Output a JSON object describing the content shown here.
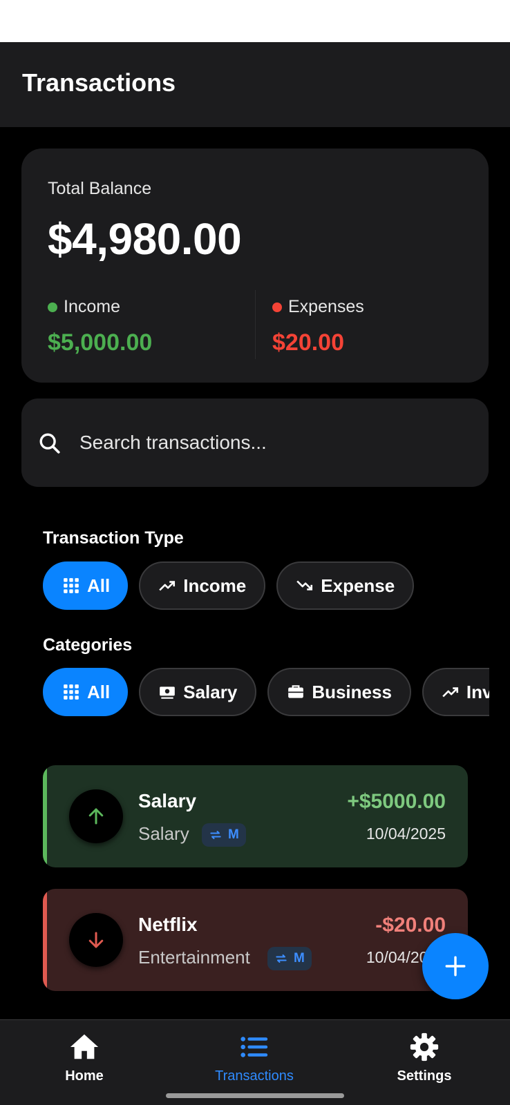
{
  "app_bar": {
    "title": "Transactions"
  },
  "balance": {
    "label": "Total Balance",
    "amount": "$4,980.00",
    "income": {
      "label": "Income",
      "value": "$5,000.00",
      "color": "#4caf50"
    },
    "expenses": {
      "label": "Expenses",
      "value": "$20.00",
      "color": "#f44336"
    }
  },
  "search": {
    "placeholder": "Search transactions...",
    "icon": "search-icon"
  },
  "filters": {
    "type_title": "Transaction Type",
    "types": [
      {
        "label": "All",
        "icon": "grid-icon",
        "active": true
      },
      {
        "label": "Income",
        "icon": "trending-up-icon",
        "active": false
      },
      {
        "label": "Expense",
        "icon": "trending-down-icon",
        "active": false
      }
    ],
    "category_title": "Categories",
    "categories": [
      {
        "label": "All",
        "icon": "grid-icon",
        "active": true
      },
      {
        "label": "Salary",
        "icon": "money-icon",
        "active": false
      },
      {
        "label": "Business",
        "icon": "briefcase-icon",
        "active": false
      },
      {
        "label": "Inv",
        "icon": "trending-up-icon",
        "active": false
      }
    ]
  },
  "transactions": [
    {
      "title": "Salary",
      "category": "Salary",
      "badge": "M",
      "amount": "+$5000.00",
      "date": "10/04/2025",
      "kind": "income",
      "amount_color": "#7ec97f",
      "accent": "#5cb85c"
    },
    {
      "title": "Netflix",
      "category": "Entertainment",
      "badge": "M",
      "amount": "-$20.00",
      "date": "10/04/2025",
      "kind": "expense",
      "amount_color": "#f0807a",
      "accent": "#e05a50"
    }
  ],
  "bottom_nav": [
    {
      "label": "Home",
      "icon": "home-icon",
      "active": false
    },
    {
      "label": "Transactions",
      "icon": "list-icon",
      "active": true
    },
    {
      "label": "Settings",
      "icon": "gear-icon",
      "active": false
    }
  ],
  "colors": {
    "accent": "#0a84ff",
    "surface": "#1c1c1e",
    "background": "#000000"
  }
}
